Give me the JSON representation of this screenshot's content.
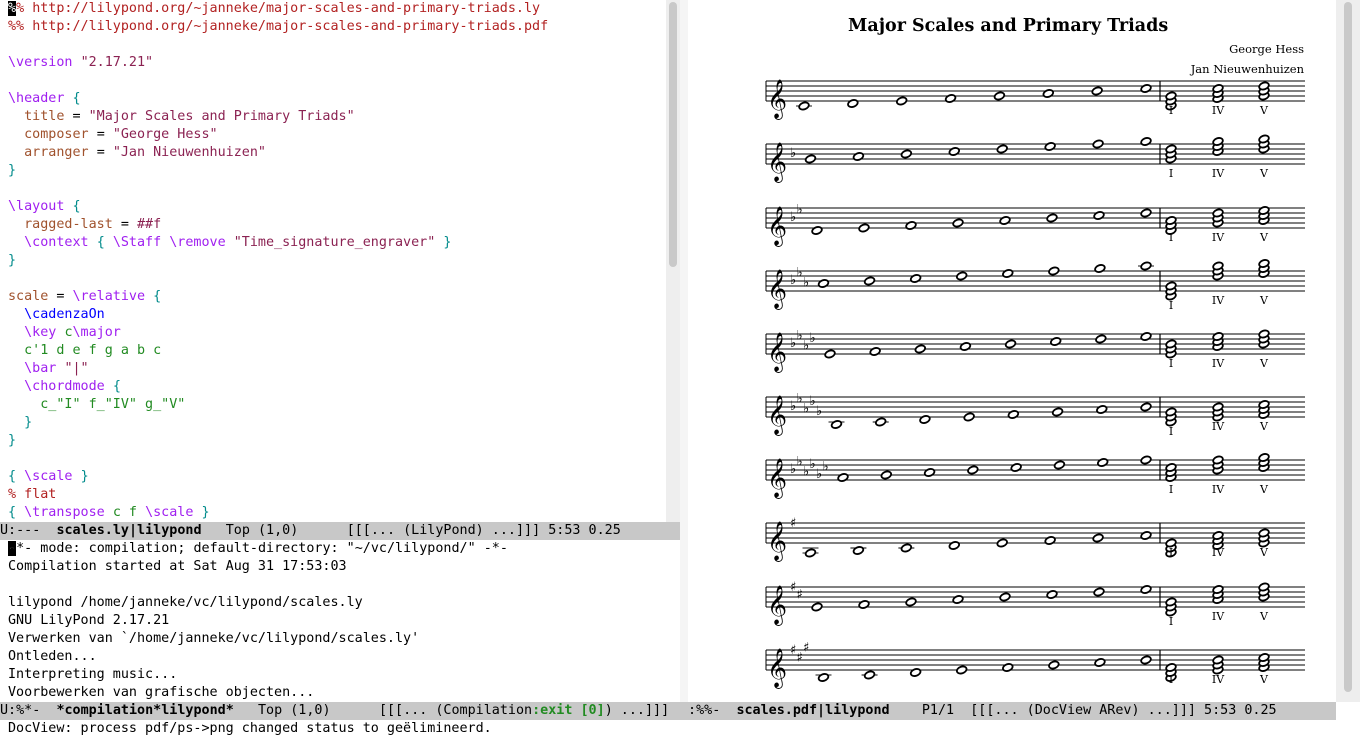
{
  "editor": {
    "url1": "http://lilypond.org/~janneke/major-scales-and-primary-triads.ly",
    "url2": "http://lilypond.org/~janneke/major-scales-and-primary-triads.pdf",
    "version_cmd": "\\version",
    "version_val": "\"2.17.21\"",
    "header_cmd": "\\header",
    "title_key": "title",
    "title_val": "\"Major Scales and Primary Triads\"",
    "composer_key": "composer",
    "composer_val": "\"George Hess\"",
    "arranger_key": "arranger",
    "arranger_val": "\"Jan Nieuwenhuizen\"",
    "layout_cmd": "\\layout",
    "ragged_key": "ragged-last",
    "ragged_val": "##f",
    "context_cmd": "\\context",
    "staff_cmd": "\\Staff",
    "remove_cmd": "\\remove",
    "engraver_val": "\"Time_signature_engraver\"",
    "scale_name": "scale",
    "relative_cmd": "\\relative",
    "cadenza_cmd": "\\cadenzaOn",
    "key_cmd": "\\key",
    "key_arg": "c",
    "major_cmd": "\\major",
    "notes": "c'1 d e f g a b c",
    "bar_cmd": "\\bar",
    "bar_val": "\"|\"",
    "chordmode_cmd": "\\chordmode",
    "chords": "c_\"I\" f_\"IV\" g_\"V\"",
    "scale_cmd": "\\scale",
    "flat_comment": "% flat",
    "transpose_cmd": "\\transpose",
    "transpose_args": "c f",
    "eq": "=",
    "open_brace": "{",
    "close_brace": "}"
  },
  "modeline_top": {
    "state": "U:---  ",
    "buffer": "scales.ly|lilypond",
    "position": "   Top (1,0)      ",
    "info": "[[[... (LilyPond) ...]]] 5:53 0.25"
  },
  "compilation": {
    "header_line": "-*- mode: compilation; default-directory: \"~/vc/lilypond/\" -*-",
    "started": "Compilation started at Sat Aug 31 17:53:03",
    "command": "lilypond /home/janneke/vc/lilypond/scales.ly",
    "gnu": "GNU LilyPond 2.17.21",
    "processing": "Verwerken van `/home/janneke/vc/lilypond/scales.ly'",
    "parsing": "Ontleden...",
    "interpreting": "Interpreting music...",
    "preprocessing": "Voorbewerken van grafische objecten..."
  },
  "modeline_bottom_left": {
    "state": "U:%*-  ",
    "buffer": "*compilation*lilypond*",
    "position": "   Top (1,0)      ",
    "info_a": "[[[... (Compilation",
    "info_exit": ":exit [0]",
    "info_b": ") ...]]]"
  },
  "modeline_bottom_right": {
    "state": " :%%-  ",
    "buffer": "scales.pdf|lilypond",
    "position": "    P1/1  ",
    "info": "[[[... (DocView ARev) ...]]] 5:53 0.25"
  },
  "echo_area": "DocView: process pdf/ps->png changed status to geëlimineerd.",
  "pdf": {
    "title": "Major Scales and Primary Triads",
    "composer": "George Hess",
    "arranger": "Jan Nieuwenhuizen",
    "chord_labels": [
      "I",
      "IV",
      "V"
    ],
    "systems": [
      {
        "key": "C major",
        "accidentals": 0,
        "acc_type": "natural"
      },
      {
        "key": "F major",
        "accidentals": 1,
        "acc_type": "flat"
      },
      {
        "key": "Bb major",
        "accidentals": 2,
        "acc_type": "flat"
      },
      {
        "key": "Eb major",
        "accidentals": 3,
        "acc_type": "flat"
      },
      {
        "key": "Ab major",
        "accidentals": 4,
        "acc_type": "flat"
      },
      {
        "key": "Db major",
        "accidentals": 5,
        "acc_type": "flat"
      },
      {
        "key": "Gb major",
        "accidentals": 6,
        "acc_type": "flat"
      },
      {
        "key": "G major",
        "accidentals": 1,
        "acc_type": "sharp"
      },
      {
        "key": "D major",
        "accidentals": 2,
        "acc_type": "sharp"
      },
      {
        "key": "A major",
        "accidentals": 3,
        "acc_type": "sharp"
      }
    ]
  }
}
